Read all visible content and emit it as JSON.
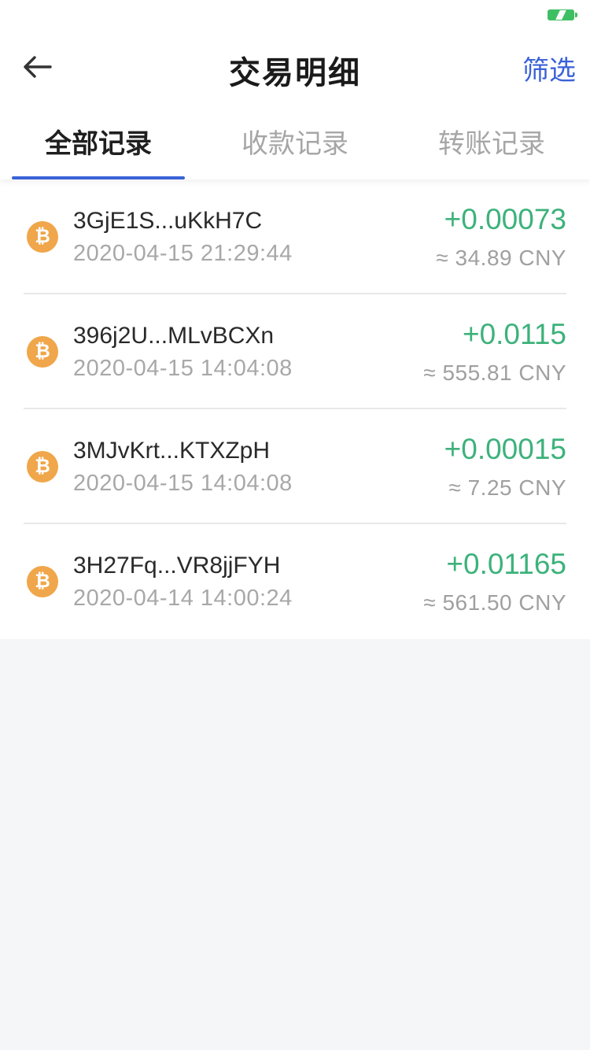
{
  "header": {
    "title": "交易明细",
    "filter_label": "筛选"
  },
  "tabs": [
    {
      "label": "全部记录",
      "active": true
    },
    {
      "label": "收款记录",
      "active": false
    },
    {
      "label": "转账记录",
      "active": false
    }
  ],
  "transactions": [
    {
      "address": "3GjE1S...uKkH7C",
      "time": "2020-04-15 21:29:44",
      "amount": "+0.00073",
      "fiat": "≈ 34.89 CNY"
    },
    {
      "address": "396j2U...MLvBCXn",
      "time": "2020-04-15 14:04:08",
      "amount": "+0.0115",
      "fiat": "≈ 555.81 CNY"
    },
    {
      "address": "3MJvKrt...KTXZpH",
      "time": "2020-04-15 14:04:08",
      "amount": "+0.00015",
      "fiat": "≈ 7.25 CNY"
    },
    {
      "address": "3H27Fq...VR8jjFYH",
      "time": "2020-04-14 14:00:24",
      "amount": "+0.01165",
      "fiat": "≈ 561.50 CNY"
    }
  ],
  "icons": {
    "coin": "bitcoin-icon",
    "coin_glyph": "₿",
    "back": "arrow-left-icon",
    "battery": "battery-charging-icon"
  },
  "colors": {
    "accent": "#3a62d7",
    "positive_amount": "#3db27b",
    "coin": "#f0a64a",
    "battery": "#3fbf63"
  }
}
